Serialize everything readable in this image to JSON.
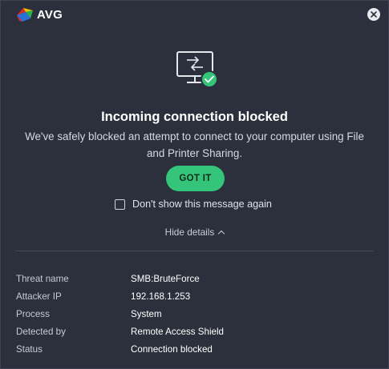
{
  "app": {
    "brand": "AVG"
  },
  "colors": {
    "background": "#2b303c",
    "accent_green": "#34c47a",
    "logo_red": "#d92a2a",
    "logo_yellow": "#f2c400",
    "logo_green": "#2bb24c",
    "logo_blue": "#2a6fd6"
  },
  "icons": {
    "close": "close-icon",
    "hero": "blocked-connection-monitor-icon",
    "check": "check-badge-icon"
  },
  "dialog": {
    "headline": "Incoming connection blocked",
    "message": "We've safely blocked an attempt to connect to your computer using File and Printer Sharing.",
    "primary_button": "GOT IT",
    "checkbox_label": "Don't show this message again",
    "checkbox_checked": false,
    "toggle_details": "Hide details"
  },
  "details": [
    {
      "key": "Threat name",
      "value": "SMB:BruteForce"
    },
    {
      "key": "Attacker IP",
      "value": "192.168.1.253"
    },
    {
      "key": "Process",
      "value": "System"
    },
    {
      "key": "Detected by",
      "value": "Remote Access Shield"
    },
    {
      "key": "Status",
      "value": "Connection blocked"
    }
  ]
}
